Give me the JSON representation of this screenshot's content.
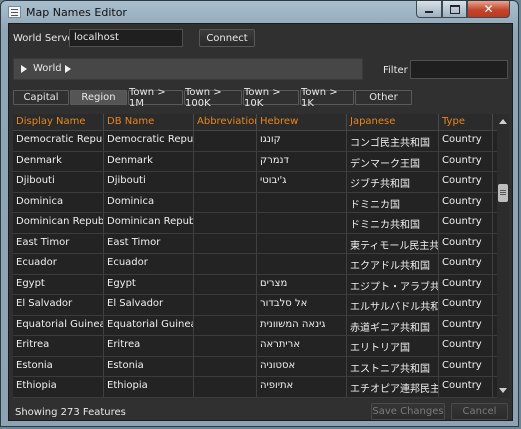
{
  "window": {
    "title": "Map Names Editor",
    "close_glyph": "✕"
  },
  "toolbar": {
    "server_label": "World Server",
    "server_value": "localhost",
    "connect_label": "Connect",
    "breadcrumb": "World",
    "filter_label": "Filter :",
    "filter_value": ""
  },
  "tabs": [
    "Capital",
    "Region",
    "Town > 1M",
    "Town > 100K",
    "Town > 10K",
    "Town > 1K",
    "Other"
  ],
  "active_tab": "Region",
  "table": {
    "columns": [
      "Display Name",
      "DB Name",
      "Abbreviations",
      "Hebrew",
      "Japanese",
      "Type"
    ],
    "rows": [
      [
        "Democratic Republic",
        "Democratic Republic",
        "",
        "קונגו",
        "コンゴ民主共和国",
        "Country"
      ],
      [
        "Denmark",
        "Denmark",
        "",
        "דנמרק",
        "デンマーク王国",
        "Country"
      ],
      [
        "Djibouti",
        "Djibouti",
        "",
        "ג'יבוטי",
        "ジブチ共和国",
        "Country"
      ],
      [
        "Dominica",
        "Dominica",
        "",
        "",
        "ドミニカ国",
        "Country"
      ],
      [
        "Dominican Republic",
        "Dominican Republic",
        "",
        "",
        "ドミニカ共和国",
        "Country"
      ],
      [
        "East Timor",
        "East Timor",
        "",
        "",
        "東ティモール民主共",
        "Country"
      ],
      [
        "Ecuador",
        "Ecuador",
        "",
        "",
        "エクアドル共和国",
        "Country"
      ],
      [
        "Egypt",
        "Egypt",
        "",
        "מצרים",
        "エジプト・アラブ共",
        "Country"
      ],
      [
        "El Salvador",
        "El Salvador",
        "",
        "אל סלבדור",
        "エルサルバドル共和",
        "Country"
      ],
      [
        "Equatorial Guinea",
        "Equatorial Guinea",
        "",
        "גינאה המשוונית",
        "赤道ギニア共和国",
        "Country"
      ],
      [
        "Eritrea",
        "Eritrea",
        "",
        "אריתראה",
        "エリトリア国",
        "Country"
      ],
      [
        "Estonia",
        "Estonia",
        "",
        "אסטוניה",
        "エストニア共和国",
        "Country"
      ],
      [
        "Ethiopia",
        "Ethiopia",
        "",
        "אתיופיה",
        "エチオピア連邦民主",
        "Country"
      ]
    ]
  },
  "footer": {
    "status": "Showing 273 Features",
    "save_label": "Save Changes",
    "cancel_label": "Cancel"
  }
}
